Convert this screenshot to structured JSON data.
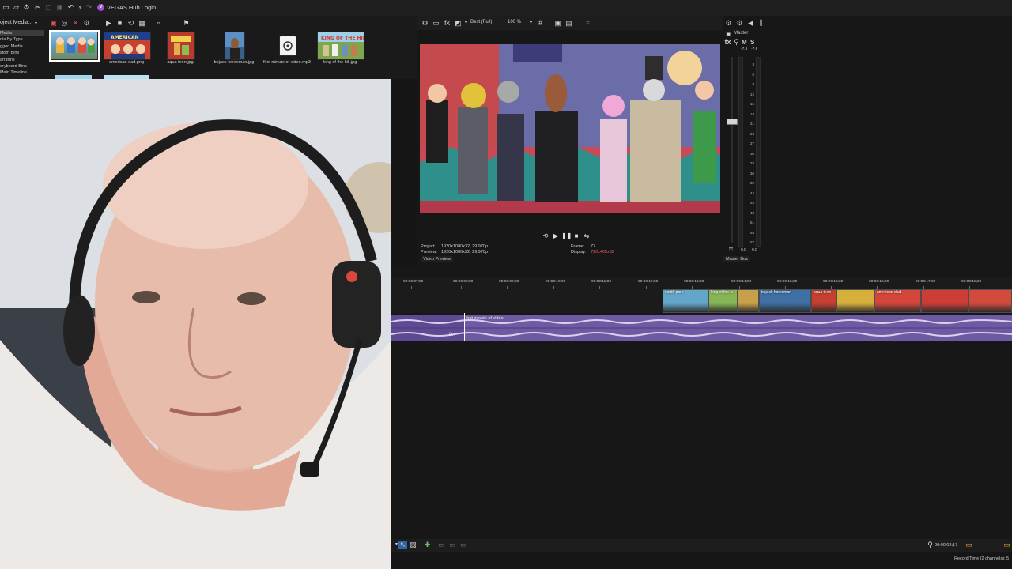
{
  "app": {
    "hub_label": "VEGAS Hub Login"
  },
  "media_panel": {
    "dropdown_label": "oject Media...",
    "tree_items": [
      "Media",
      "dia By Type",
      "gged Media",
      "stom Bins",
      "art Bins",
      "oryboard Bins",
      "Main Timeline"
    ],
    "files": [
      {
        "name": "",
        "color": "#6fa5c9"
      },
      {
        "name": "american dad.png",
        "color": "#c8412e"
      },
      {
        "name": "aqua teen.jpg",
        "color": "#b83a2c"
      },
      {
        "name": "bojack horseman.jpg",
        "color": "#3b5f8b"
      },
      {
        "name": "first minute of video.mp3",
        "color": "#f2f2f2"
      },
      {
        "name": "king of the hill.jpg",
        "color": "#7ea64d"
      }
    ]
  },
  "preview": {
    "quality": "Best (Full)",
    "zoom": "100 %",
    "project_label": "Project:",
    "project_value": "1920x1080x32, 29.970p",
    "preview_label": "Preview:",
    "preview_value": "1920x1080x32, 29.970p",
    "frame_label": "Frame:",
    "frame_value": "77",
    "display_label": "Display:",
    "display_value": "720x405x32",
    "tab_label": "Video Preview"
  },
  "master": {
    "title": "Master",
    "mute": "M",
    "solo": "S",
    "left_peak": "-7.6",
    "right_peak": "-7.6",
    "scale": [
      "3",
      "6",
      "9",
      "12",
      "15",
      "18",
      "21",
      "24",
      "27",
      "30",
      "33",
      "36",
      "39",
      "42",
      "45",
      "48",
      "51",
      "54",
      "57"
    ],
    "bottom_left": "0.0",
    "bottom_right": "0.0",
    "tab_label": "Master Bus"
  },
  "timeline": {
    "ruler": [
      "00:00:07;00",
      "00:00:08;00",
      "00:00:09;00",
      "00:00:10;00",
      "00:00:11;00",
      "00:00:12;00",
      "00:00:13;00",
      "00:00:14;00",
      "00:00:15;00",
      "00:00:16;00",
      "00:00:16;29",
      "00:00:17;29",
      "00:00:18;29"
    ],
    "video_clips": [
      {
        "label": "south park",
        "color": "#63a6c9"
      },
      {
        "label": "king of the hi",
        "color": "#86b457"
      },
      {
        "label": "",
        "color": "#c9a04a"
      },
      {
        "label": "bojack horseman",
        "color": "#3f6fa3"
      },
      {
        "label": "aqua teen",
        "color": "#c63f31"
      },
      {
        "label": "",
        "color": "#d7b03c"
      },
      {
        "label": "american dad",
        "color": "#d4463a"
      },
      {
        "label": "",
        "color": "#cc3d35"
      },
      {
        "label": "",
        "color": "#d24a3c"
      }
    ],
    "audio_clip_label": "first minute of video",
    "cursor_time": "00:00:02;17",
    "record_time": "Record Time (2 channels): 5"
  }
}
